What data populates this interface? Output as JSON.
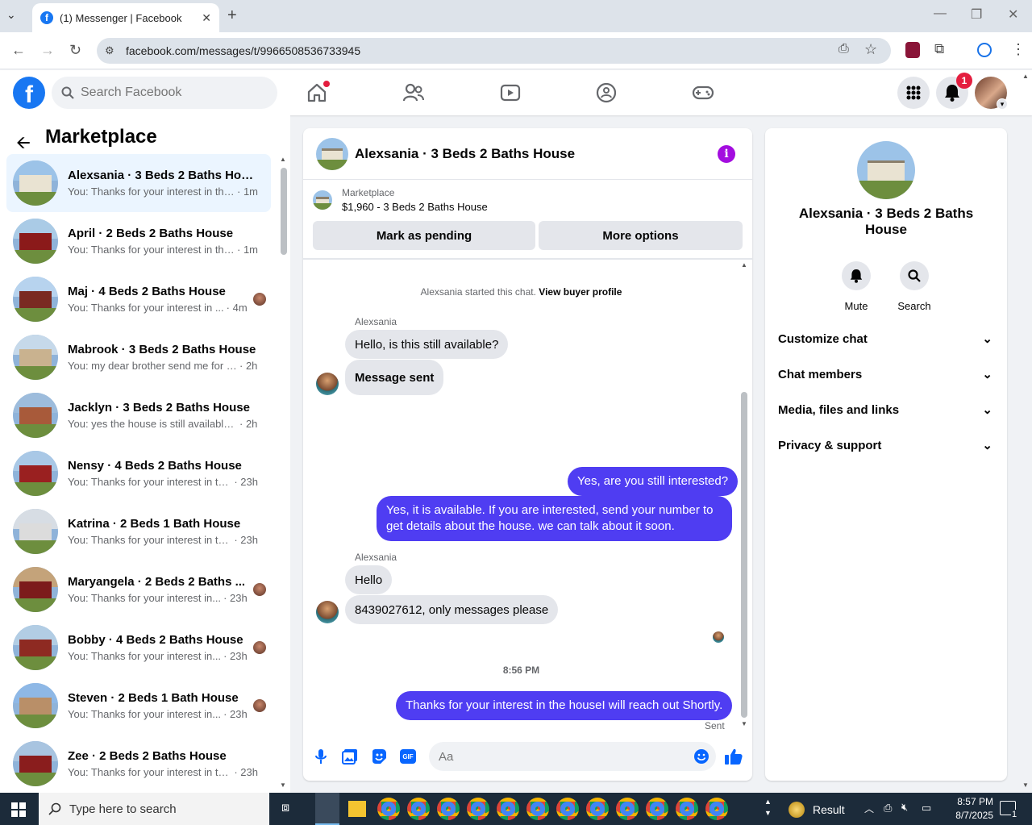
{
  "browser": {
    "tab_title": "(1) Messenger | Facebook",
    "url": "facebook.com/messages/t/9966508536733945"
  },
  "header": {
    "search_placeholder": "Search Facebook",
    "notif_count": "1"
  },
  "left": {
    "title": "Marketplace",
    "conversations": [
      {
        "name": "Alexsania · 3 Beds 2 Baths House",
        "preview": "You: Thanks for your interest in the...",
        "time": "· 1m",
        "active": true
      },
      {
        "name": "April · 2 Beds 2 Baths House",
        "preview": "You: Thanks for your interest in the...",
        "time": "· 1m"
      },
      {
        "name": "Maj · 4 Beds 2 Baths House",
        "preview": "You: Thanks for your interest in ...",
        "time": "· 4m"
      },
      {
        "name": "Mabrook · 3 Beds 2 Baths House",
        "preview": "You: my dear brother send me for t...",
        "time": "· 2h"
      },
      {
        "name": "Jacklyn · 3 Beds 2 Baths House",
        "preview": "You: yes the house is still available f...",
        "time": "· 2h"
      },
      {
        "name": "Nensy · 4 Beds 2 Baths House",
        "preview": "You: Thanks for your interest in th...",
        "time": "· 23h"
      },
      {
        "name": "Katrina · 2 Beds 1 Bath House",
        "preview": "You: Thanks for your interest in th...",
        "time": "· 23h"
      },
      {
        "name": "Maryangela · 2 Beds 2 Baths ...",
        "preview": "You: Thanks for your interest in...",
        "time": "· 23h"
      },
      {
        "name": "Bobby · 4 Beds 2 Baths House",
        "preview": "You: Thanks for your interest in...",
        "time": "· 23h"
      },
      {
        "name": "Steven · 2 Beds 1 Bath House",
        "preview": "You: Thanks for your interest in...",
        "time": "· 23h"
      },
      {
        "name": "Zee · 2 Beds 2 Baths House",
        "preview": "You: Thanks for your interest in th...",
        "time": "· 23h"
      }
    ]
  },
  "chat": {
    "title": "Alexsania · 3 Beds 2 Baths House",
    "marketplace_label": "Marketplace",
    "listing": "$1,960 - 3 Beds 2 Baths House",
    "mark_pending": "Mark as pending",
    "more_options": "More options",
    "system_text": "Alexsania started this chat.",
    "system_link": "View buyer profile",
    "sender1": "Alexsania",
    "msg1": "Hello, is this still available?",
    "msg2": "Message sent",
    "out1": "Yes, are you still interested?",
    "out2": "Yes, it is available. If you are interested, send your number to get details about the house. we can talk about it soon.",
    "sender2": "Alexsania",
    "msg3": "Hello",
    "msg4": "8439027612, only messages please",
    "timestamp": "8:56 PM",
    "out3": "Thanks for your interest in the houseI will reach out Shortly.",
    "sent_label": "Sent",
    "composer_placeholder": "Aa"
  },
  "right": {
    "name": "Alexsania · 3 Beds 2 Baths House",
    "mute": "Mute",
    "search": "Search",
    "rows": [
      "Customize chat",
      "Chat members",
      "Media, files and links",
      "Privacy & support"
    ]
  },
  "taskbar": {
    "search_placeholder": "Type here to search",
    "result": "Result",
    "time": "8:57 PM",
    "date": "8/7/2025",
    "notif": "1"
  },
  "colors": {
    "fb_blue": "#1877f2",
    "outgoing_bubble": "#4f3df2",
    "incoming_bubble": "#e4e6eb",
    "active_row": "#ebf5ff"
  }
}
